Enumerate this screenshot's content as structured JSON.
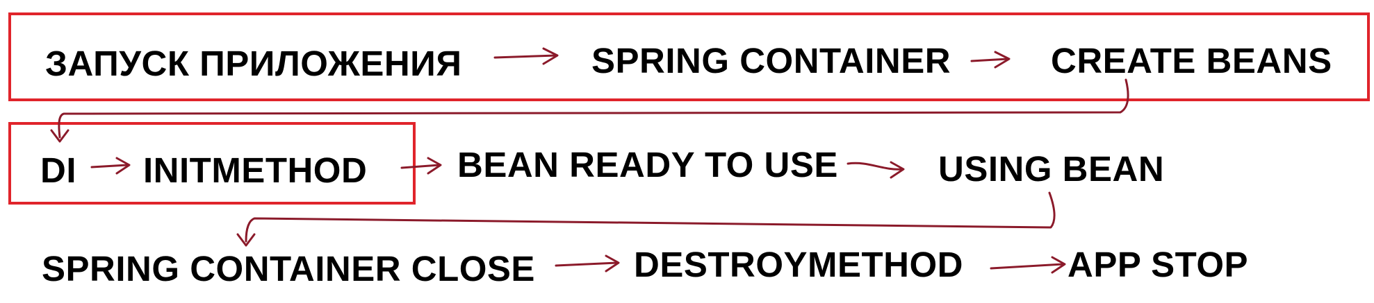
{
  "colors": {
    "box_outline": "#e0242b",
    "arrow": "#8b1a2a",
    "text": "#000000",
    "background": "#ffffff"
  },
  "rows": [
    {
      "steps": [
        {
          "id": "app_start",
          "label": "ЗАПУСК ПРИЛОЖЕНИЯ"
        },
        {
          "id": "spring_container",
          "label": "SPRING CONTAINER"
        },
        {
          "id": "create_beans",
          "label": "CREATE BEANS"
        }
      ]
    },
    {
      "steps": [
        {
          "id": "di",
          "label": "DI"
        },
        {
          "id": "init_method",
          "label": "INITMETHOD"
        },
        {
          "id": "bean_ready",
          "label": "BEAN READY TO USE"
        },
        {
          "id": "using_bean",
          "label": "USING BEAN"
        }
      ]
    },
    {
      "steps": [
        {
          "id": "container_close",
          "label": "SPRING CONTAINER CLOSE"
        },
        {
          "id": "destroy_method",
          "label": "DESTROYMETHOD"
        },
        {
          "id": "app_stop",
          "label": "APP STOP"
        }
      ]
    }
  ]
}
